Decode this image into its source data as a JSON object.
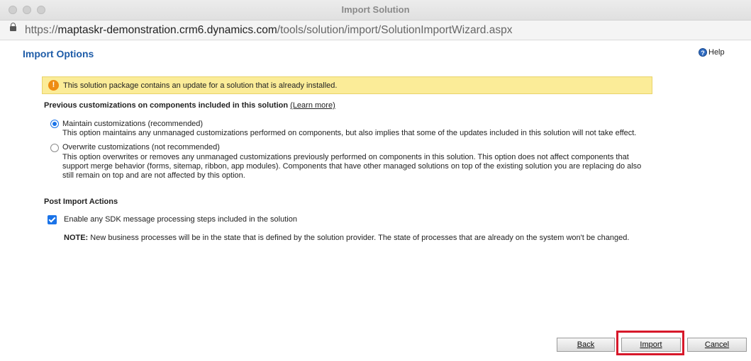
{
  "window": {
    "title": "Import Solution"
  },
  "address_bar": {
    "url_prefix": "https://",
    "url_host": "maptaskr-demonstration.crm6.dynamics.com",
    "url_path": "/tools/solution/import/SolutionImportWizard.aspx"
  },
  "page": {
    "heading": "Import Options",
    "help_label": "Help",
    "help_icon": "question-circle-icon"
  },
  "warning": {
    "icon": "exclamation-icon",
    "text": "This solution package contains an update for a solution that is already installed."
  },
  "customizations": {
    "title": "Previous customizations on components included in this solution",
    "learn_more": "(Learn more)",
    "options": [
      {
        "label": "Maintain customizations (recommended)",
        "description": "This option maintains any unmanaged customizations performed on components, but also implies that some of the updates included in this solution will not take effect.",
        "selected": true
      },
      {
        "label": "Overwrite customizations (not recommended)",
        "description": "This option overwrites or removes any unmanaged customizations previously performed on components in this solution. This option does not affect components that support merge behavior (forms, sitemap, ribbon, app modules). Components that have other managed solutions on top of the existing solution you are replacing do also still remain on top and are not affected by this option.",
        "selected": false
      }
    ]
  },
  "post_import": {
    "title": "Post Import Actions",
    "sdk_label": "Enable any SDK message processing steps included in the solution",
    "sdk_checked": true,
    "note_label": "NOTE:",
    "note_text": "New business processes will be in the state that is defined by the solution provider. The state of processes that are already on the system won't be changed."
  },
  "buttons": {
    "back": "Back",
    "import": "Import",
    "cancel": "Cancel"
  },
  "colors": {
    "accent": "#1a73e8",
    "heading": "#1e5ca8",
    "warning_bg": "#fbec98",
    "highlight": "#d7182a"
  }
}
